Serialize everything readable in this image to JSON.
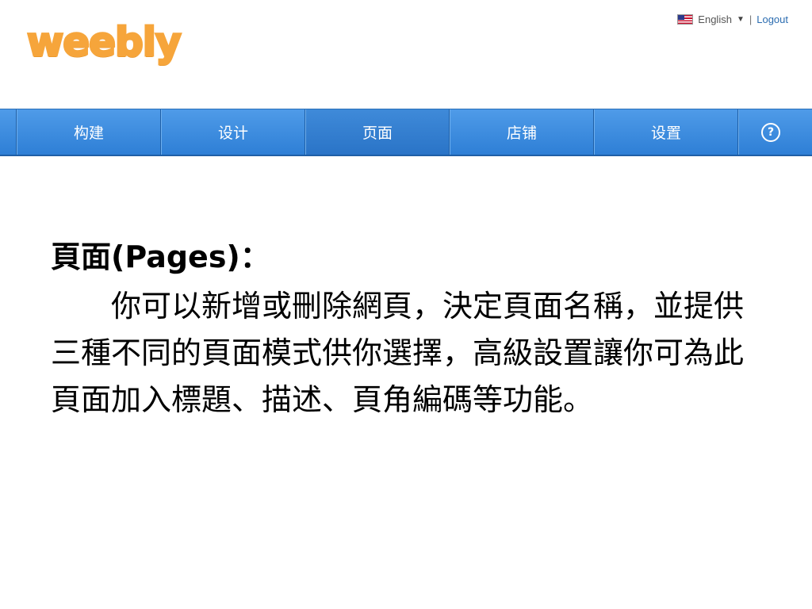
{
  "header": {
    "logo_text": "weebly",
    "language_label": "English",
    "separator": "|",
    "logout_label": "Logout"
  },
  "nav": {
    "items": [
      {
        "label": "构建"
      },
      {
        "label": "设计"
      },
      {
        "label": "页面"
      },
      {
        "label": "店铺"
      },
      {
        "label": "设置"
      }
    ],
    "help_symbol": "?"
  },
  "content": {
    "heading": "頁面(Pages)：",
    "paragraph": "你可以新增或刪除網頁，決定頁面名稱，並提供三種不同的頁面模式供你選擇，高級設置讓你可為此頁面加入標題、描述、頁角編碼等功能。"
  }
}
